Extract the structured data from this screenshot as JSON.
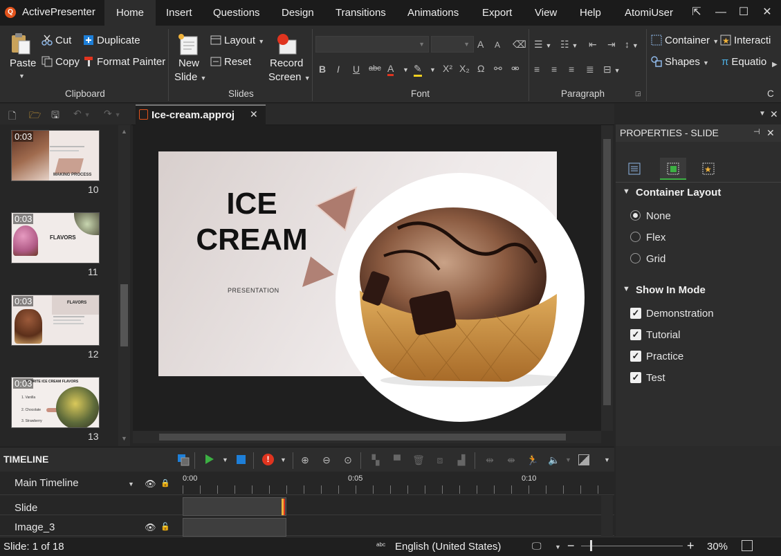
{
  "app": {
    "name": "ActivePresenter",
    "user": "AtomiUser"
  },
  "menu": [
    "Home",
    "Insert",
    "Questions",
    "Design",
    "Transitions",
    "Animations",
    "Export",
    "View",
    "Help"
  ],
  "window_controls": {
    "restore": "⇱",
    "minimize": "—",
    "maximize": "☐",
    "close": "✕"
  },
  "ribbon": {
    "clipboard": {
      "label": "Clipboard",
      "paste": "Paste",
      "cut": "Cut",
      "copy": "Copy",
      "duplicate": "Duplicate",
      "format_painter": "Format Painter"
    },
    "slides": {
      "label": "Slides",
      "new_slide_1": "New",
      "new_slide_2": "Slide",
      "layout": "Layout",
      "reset": "Reset",
      "record_1": "Record",
      "record_2": "Screen"
    },
    "font": {
      "label": "Font",
      "family": "",
      "size": ""
    },
    "paragraph": {
      "label": "Paragraph"
    },
    "insert": {
      "container": "Container",
      "interaction": "Interacti",
      "shapes": "Shapes",
      "equation": "Equatio",
      "next_group_label": "C"
    }
  },
  "doc_tab": {
    "title": "Ice-cream.approj"
  },
  "thumbnails": [
    {
      "dur": "0:03",
      "num": "10",
      "title": "MAKING PROCESS",
      "bg": "#efe7e4"
    },
    {
      "dur": "0:03",
      "num": "11",
      "title": "FLAVORS",
      "bg": "#f1ebe9"
    },
    {
      "dur": "0:03",
      "num": "12",
      "title": "FLAVORS",
      "bg": "#efe8e6"
    },
    {
      "dur": "0:03",
      "num": "13",
      "title": "AVORITE ICE CREAM FLAVORS",
      "bg": "#f3eeec",
      "items": [
        "1. Vanilla",
        "2. Chocolate",
        "3. Strawberry"
      ]
    }
  ],
  "slide": {
    "title_1": "ICE",
    "title_2": "CREAM",
    "subtitle": "PRESENTATION"
  },
  "properties": {
    "title": "PROPERTIES - SLIDE",
    "container_layout": {
      "label": "Container Layout",
      "options": [
        "None",
        "Flex",
        "Grid"
      ],
      "selected": "None"
    },
    "show_in_mode": {
      "label": "Show In Mode",
      "options": [
        "Demonstration",
        "Tutorial",
        "Practice",
        "Test"
      ],
      "checked": [
        true,
        true,
        true,
        true
      ]
    }
  },
  "timeline": {
    "label": "TIMELINE",
    "main": "Main Timeline",
    "ticks": [
      "0:00",
      "0:05",
      "0:10"
    ],
    "rows": [
      "Slide",
      "Image_3"
    ]
  },
  "status": {
    "slide": "Slide: 1 of 18",
    "language": "English (United States)",
    "zoom": "30%"
  },
  "colors": {
    "accent": "#e2531c",
    "record": "#e0341f",
    "play": "#3cb043",
    "stop": "#1e7fd8",
    "playhead": "#f0b23a"
  }
}
